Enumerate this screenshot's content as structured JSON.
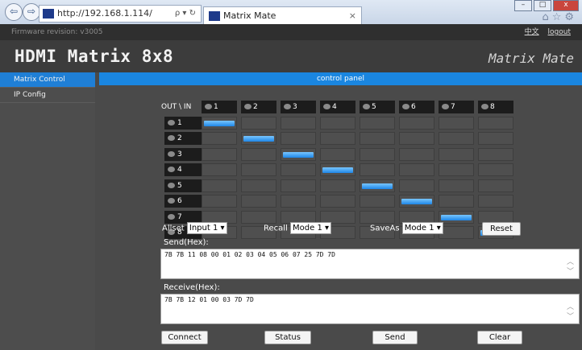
{
  "browser": {
    "url": "http://192.168.1.114/",
    "tab_title": "Matrix Mate",
    "back_glyph": "⇦",
    "forward_glyph": "⇨",
    "addr_tools": "ρ ▾ ↻",
    "tab_close": "×",
    "win_min": "–",
    "win_max": "□",
    "win_close": "x",
    "toolbar_glyphs": "⌂☆⚙"
  },
  "header": {
    "firmware": "Firmware revision: v3005",
    "lang_link": "中文",
    "logout": "logout",
    "app_title": "HDMI Matrix 8x8",
    "brand": "Matrix Mate"
  },
  "sidebar": {
    "items": [
      {
        "label": "Matrix Control",
        "active": true
      },
      {
        "label": "IP Config",
        "active": false
      }
    ]
  },
  "panel": {
    "title": "control panel"
  },
  "matrix": {
    "corner_label": "OUT \\ IN",
    "inputs": [
      "1",
      "2",
      "3",
      "4",
      "5",
      "6",
      "7",
      "8"
    ],
    "outputs": [
      "1",
      "2",
      "3",
      "4",
      "5",
      "6",
      "7",
      "8"
    ],
    "routes": [
      1,
      2,
      3,
      4,
      5,
      6,
      7,
      8
    ]
  },
  "controls": {
    "allset_label": "Allset",
    "allset_value": "Input 1",
    "recall_label": "Recall",
    "recall_value": "Mode 1",
    "saveas_label": "SaveAs",
    "saveas_value": "Mode 1",
    "reset": "Reset"
  },
  "send": {
    "label": "Send(Hex):",
    "value": "7B 7B 11 08 00 01 02 03 04 05 06 07 25 7D 7D"
  },
  "receive": {
    "label": "Receive(Hex):",
    "value": "7B 7B 12 01 00 03 7D 7D"
  },
  "buttons": {
    "connect": "Connect",
    "status": "Status",
    "send": "Send",
    "clear": "Clear"
  },
  "colors": {
    "accent": "#1a86e0",
    "active_route": "#1e86e6"
  }
}
